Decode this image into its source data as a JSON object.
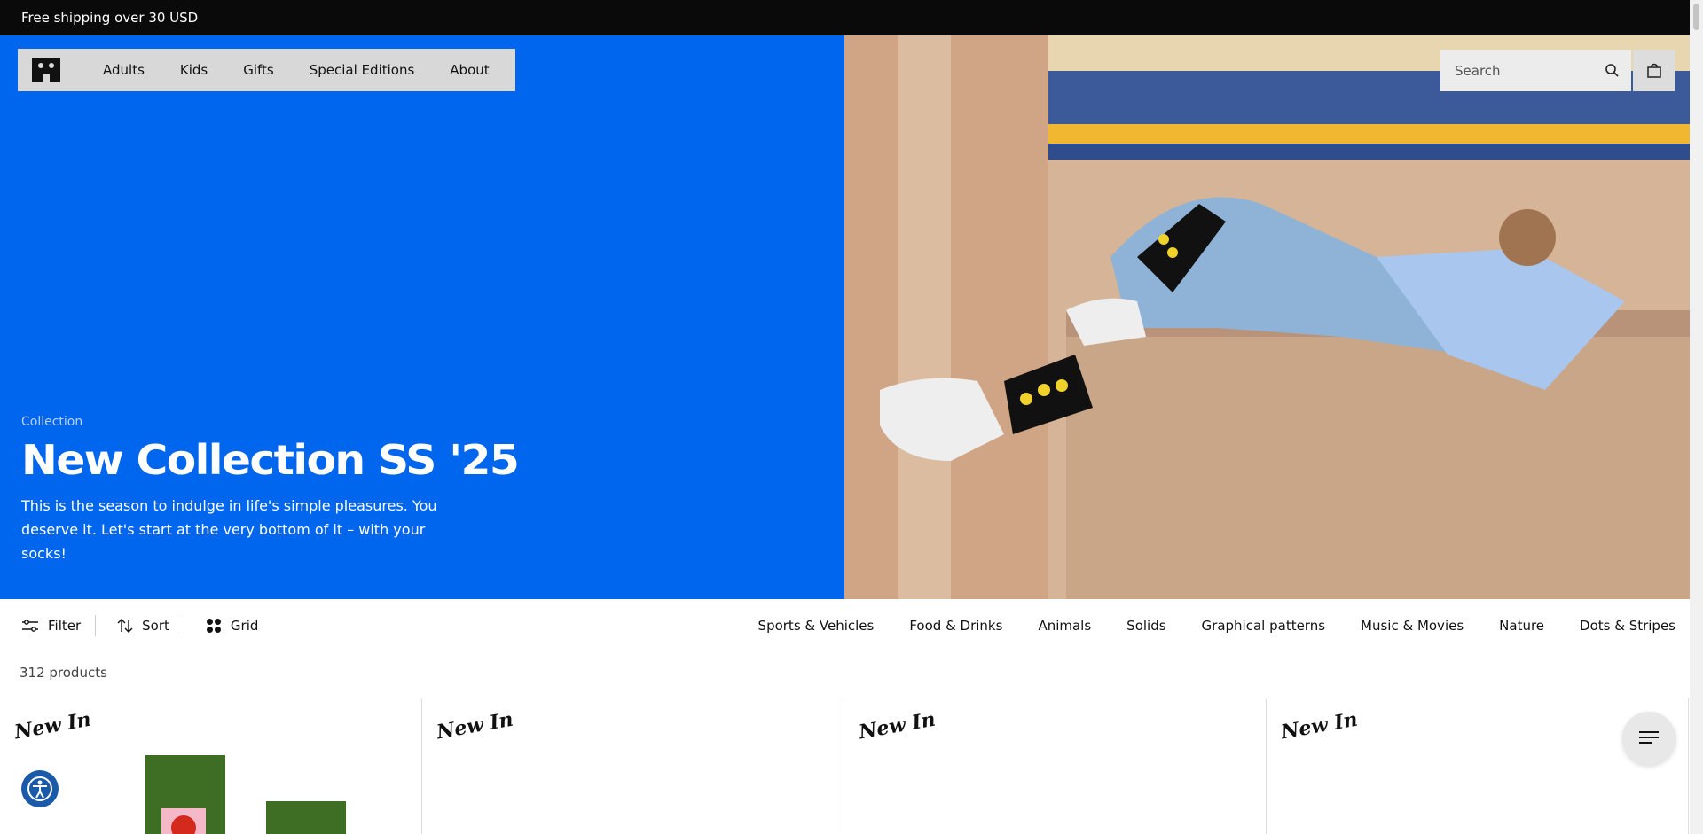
{
  "announcement": "Free shipping over 30 USD",
  "nav": {
    "items": [
      "Adults",
      "Kids",
      "Gifts",
      "Special Editions",
      "About"
    ]
  },
  "search": {
    "placeholder": "Search"
  },
  "hero": {
    "eyebrow": "Collection",
    "title": "New Collection SS '25",
    "description": "This is the season to indulge in life's simple pleasures. You deserve it. Let's start at the very bottom of it – with your socks!",
    "bg_color": "#0066ee"
  },
  "toolbar": {
    "filter_label": "Filter",
    "sort_label": "Sort",
    "grid_label": "Grid",
    "categories": [
      "Sports & Vehicles",
      "Food & Drinks",
      "Animals",
      "Solids",
      "Graphical patterns",
      "Music & Movies",
      "Nature",
      "Dots & Stripes"
    ]
  },
  "product_count": "312 products",
  "products": [
    {
      "badge": "New In",
      "color": "#3d6e23"
    },
    {
      "badge": "New In",
      "color": "#f3ede0"
    },
    {
      "badge": "New In",
      "color": "#8ab8ee"
    },
    {
      "badge": "New In",
      "color": "#f0e040"
    }
  ]
}
